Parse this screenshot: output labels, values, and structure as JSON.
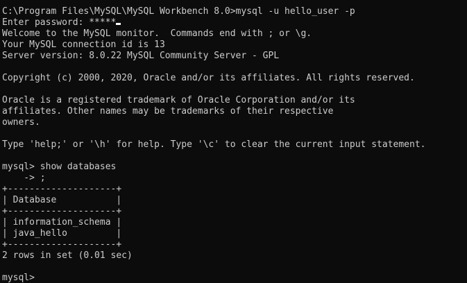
{
  "terminal": {
    "lines": [
      "C:\\Program Files\\MySQL\\MySQL Workbench 8.0>mysql -u hello_user -p",
      "Enter password: *****",
      "Welcome to the MySQL monitor.  Commands end with ; or \\g.",
      "Your MySQL connection id is 13",
      "Server version: 8.0.22 MySQL Community Server - GPL",
      "",
      "Copyright (c) 2000, 2020, Oracle and/or its affiliates. All rights reserved.",
      "",
      "Oracle is a registered trademark of Oracle Corporation and/or its",
      "affiliates. Other names may be trademarks of their respective",
      "owners.",
      "",
      "Type 'help;' or '\\h' for help. Type '\\c' to clear the current input statement.",
      "",
      "mysql> show databases",
      "    -> ;",
      "+--------------------+",
      "| Database           |",
      "+--------------------+",
      "| information_schema |",
      "| java_hello         |",
      "+--------------------+",
      "2 rows in set (0.01 sec)",
      "",
      "mysql>"
    ],
    "colors": {
      "background": "#0c0c0c",
      "foreground": "#cccccc",
      "cursor": "#ffffff"
    }
  }
}
